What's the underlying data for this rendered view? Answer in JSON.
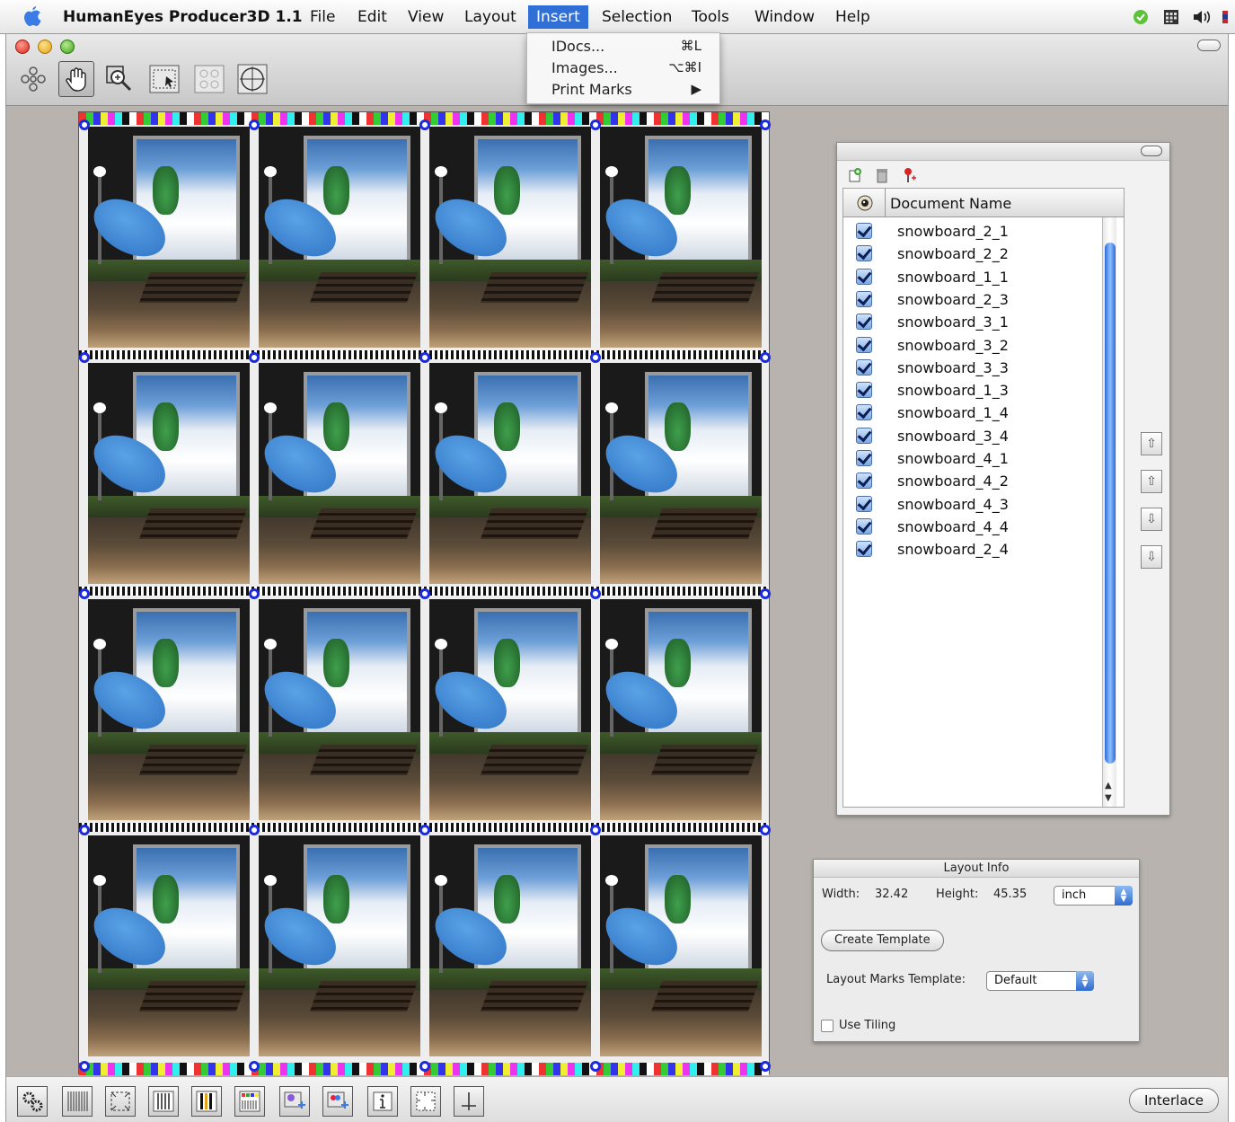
{
  "menubar": {
    "app_name": "HumanEyes Producer3D 1.1",
    "items": [
      "File",
      "Edit",
      "View",
      "Layout",
      "Insert",
      "Selection",
      "Tools",
      "Window",
      "Help"
    ],
    "active": "Insert"
  },
  "insert_menu": {
    "items": [
      {
        "label": "IDocs...",
        "shortcut": "⌘L"
      },
      {
        "label": "Images...",
        "shortcut": "⌥⌘I"
      },
      {
        "label": "Print Marks",
        "shortcut": "▶"
      }
    ]
  },
  "toolbar": {
    "tools": [
      "move-tool-icon",
      "hand-tool-icon",
      "zoom-tool-icon",
      "select-frame-icon",
      "grid-icon",
      "crop-circle-icon"
    ],
    "selected": "hand-tool-icon"
  },
  "documents_panel": {
    "column_header": "Document Name",
    "documents": [
      "snowboard_2_1",
      "snowboard_2_2",
      "snowboard_1_1",
      "snowboard_2_3",
      "snowboard_3_1",
      "snowboard_3_2",
      "snowboard_3_3",
      "snowboard_1_3",
      "snowboard_1_4",
      "snowboard_3_4",
      "snowboard_4_1",
      "snowboard_4_2",
      "snowboard_4_3",
      "snowboard_4_4",
      "snowboard_2_4"
    ]
  },
  "layout_info": {
    "title": "Layout Info",
    "width_label": "Width:",
    "width_value": "32.42",
    "height_label": "Height:",
    "height_value": "45.35",
    "unit": "inch",
    "create_template_label": "Create Template",
    "marks_template_label": "Layout Marks Template:",
    "marks_template_value": "Default",
    "use_tiling_label": "Use Tiling"
  },
  "bottom_toolbar": {
    "interlace_label": "Interlace"
  },
  "colors": {
    "accent": "#2f6fd6",
    "registration_blue": "#1b2be0"
  }
}
